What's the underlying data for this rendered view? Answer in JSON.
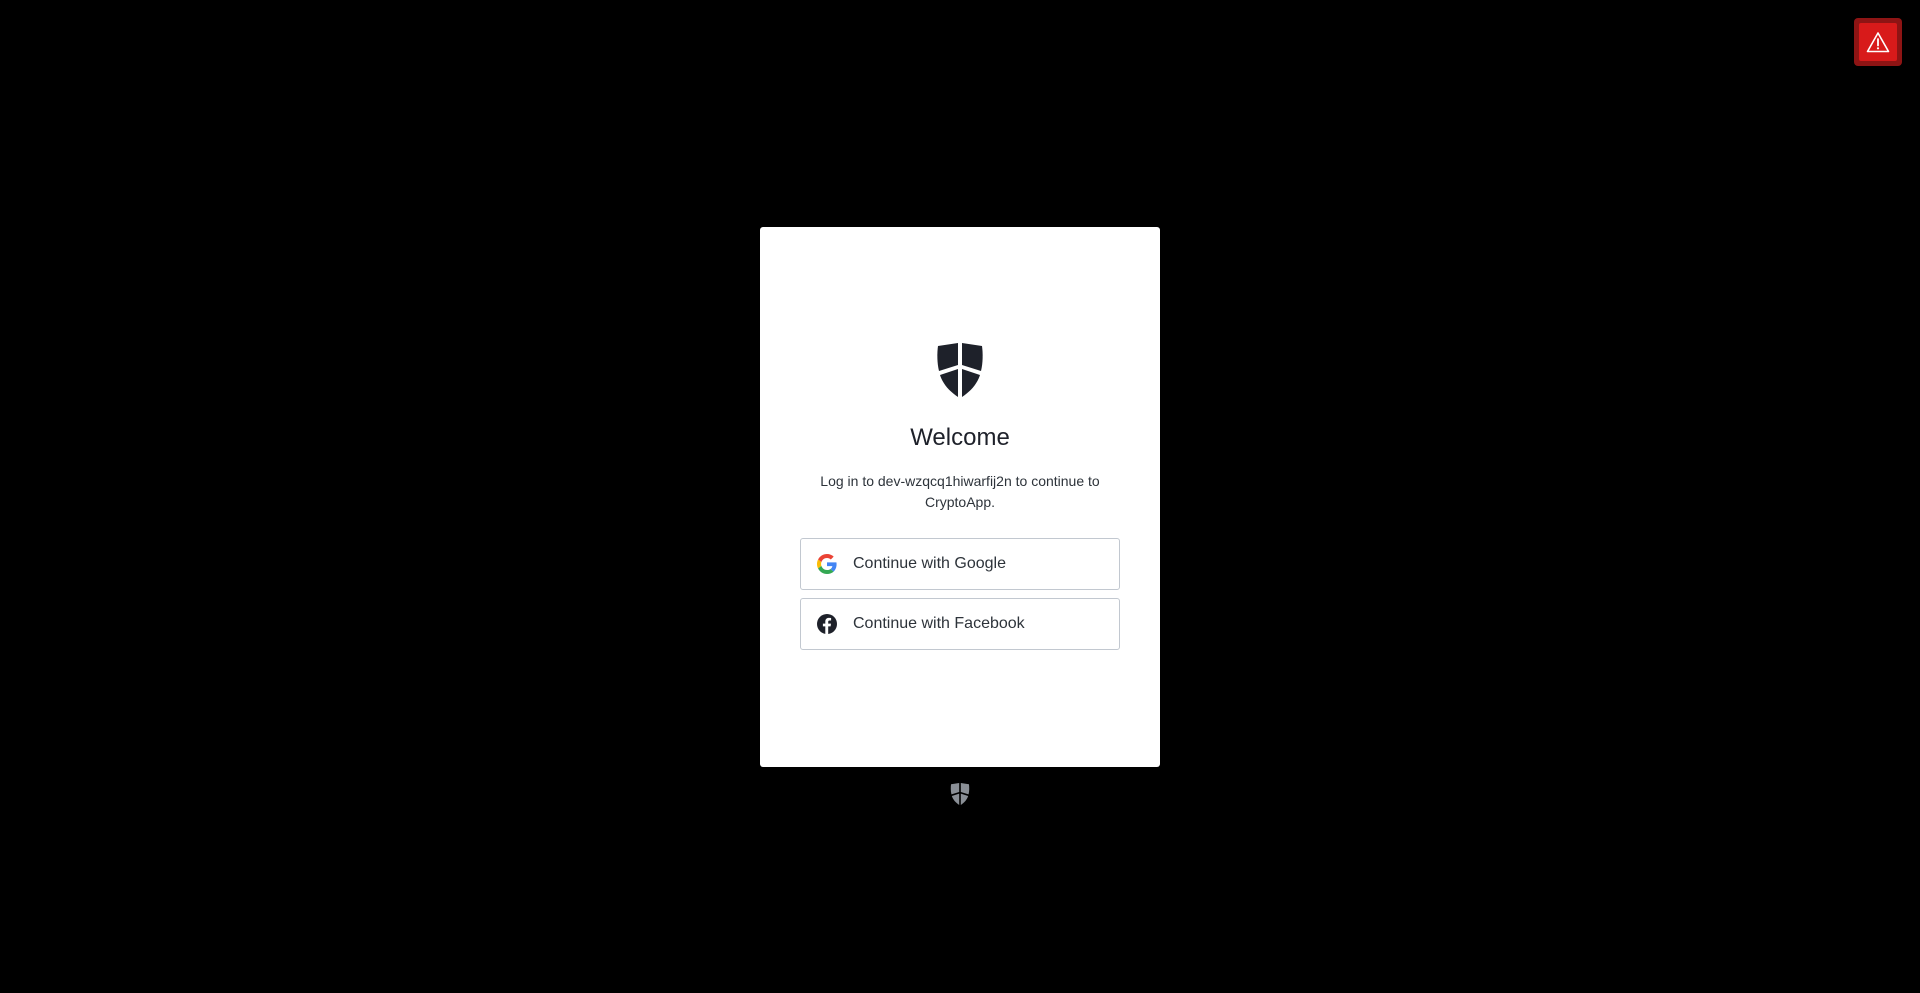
{
  "alert": {
    "icon": "warning-triangle-icon",
    "colors": {
      "outer": "#8e1414",
      "inner": "#d81a1a"
    }
  },
  "login": {
    "logo_icon": "shield-logo-icon",
    "title": "Welcome",
    "subtitle": "Log in to dev-wzqcq1hiwarfij2n to continue to CryptoApp.",
    "buttons": {
      "google": {
        "label": "Continue with Google",
        "icon": "google-icon"
      },
      "facebook": {
        "label": "Continue with Facebook",
        "icon": "facebook-icon"
      }
    }
  },
  "footer": {
    "logo_icon": "shield-logo-icon"
  }
}
